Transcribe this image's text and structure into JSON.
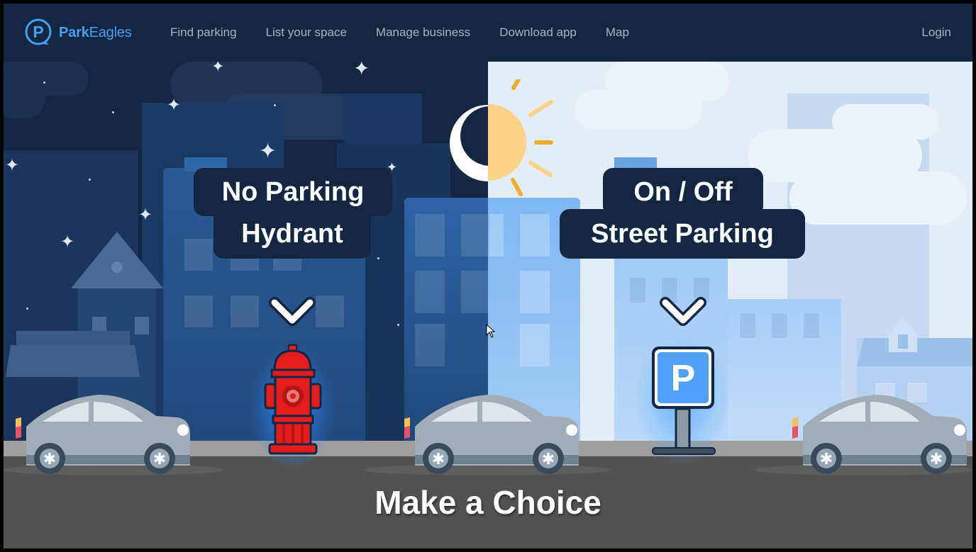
{
  "nav": {
    "logo": {
      "brand_bold": "Park",
      "brand_light": "Eagles",
      "icon": "parking-p-logo-icon"
    },
    "links": [
      {
        "label": "Find parking"
      },
      {
        "label": "List your space"
      },
      {
        "label": "Manage business"
      },
      {
        "label": "Download app"
      },
      {
        "label": "Map"
      }
    ],
    "login_label": "Login"
  },
  "hero": {
    "left_option": {
      "line1": "No Parking",
      "line2": "Hydrant",
      "icon": "fire-hydrant-icon",
      "theme": "night"
    },
    "right_option": {
      "line1": "On / Off",
      "line2": "Street Parking",
      "icon": "parking-sign-icon",
      "sign_letter": "P",
      "theme": "day"
    },
    "title": "Make a Choice"
  },
  "colors": {
    "nav_bg": "#132642",
    "brand_blue": "#4a9df0",
    "nav_text": "#a9b3c1",
    "night_sky": "#132642",
    "day_sky": "#e4ecf6",
    "hydrant_red": "#e21d1d",
    "parking_blue": "#4fa1f8",
    "road": "#525252",
    "sidewalk": "#9e9e9e",
    "sun": "#f9d38a",
    "sun_rays": "#ecae31"
  }
}
